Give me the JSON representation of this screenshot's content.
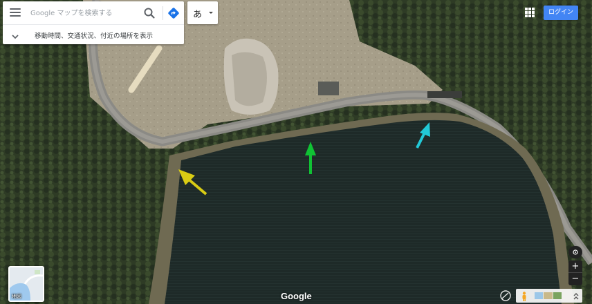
{
  "search": {
    "placeholder": "Google マップを検索する",
    "menu_icon": "hamburger-menu-icon",
    "search_icon": "magnifier-icon",
    "directions_icon": "directions-diamond-icon"
  },
  "travel_info": {
    "label": "移動時間、交通状況、付近の場所を表示",
    "icon": "chevron-down-icon"
  },
  "input_tool": {
    "char": "あ"
  },
  "header": {
    "apps_icon": "apps-grid-icon",
    "login_label": "ログイン",
    "login_color": "#4285f4"
  },
  "layer_switcher": {
    "label": "地図"
  },
  "footer": {
    "logo_text": "Google"
  },
  "controls": {
    "zoom_in": "+",
    "zoom_out": "−",
    "compass_icon": "compass-icon"
  },
  "annotations": [
    {
      "color": "#d9cc14",
      "direction": "up-left"
    },
    {
      "color": "#10c234",
      "direction": "up"
    },
    {
      "color": "#22c8d6",
      "direction": "up-right"
    }
  ],
  "map_colors": {
    "forest": "#2d3a24",
    "pond": "#1f2b29",
    "dirt": "#a29a86",
    "road": "#8a8a86"
  }
}
